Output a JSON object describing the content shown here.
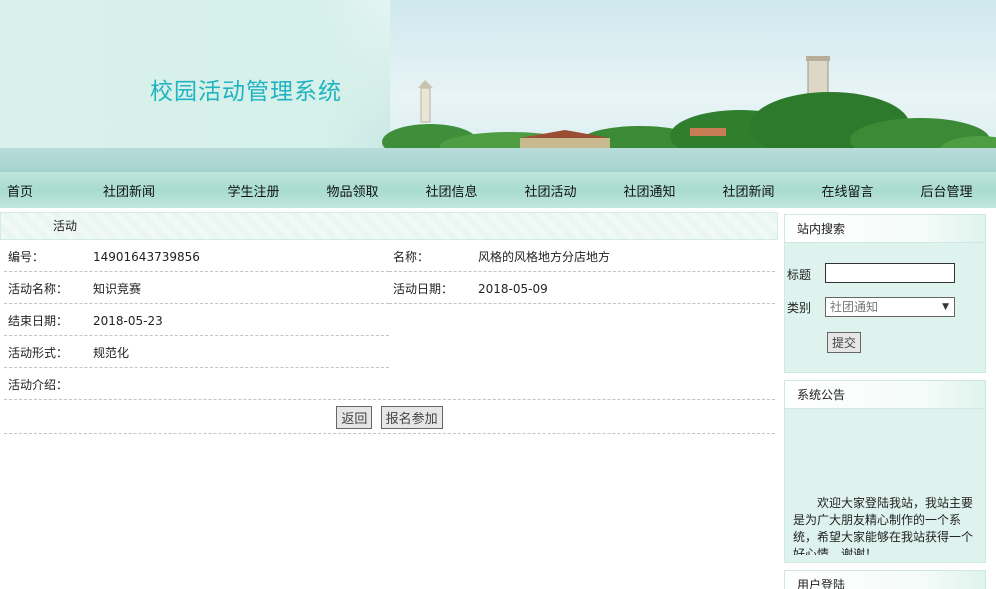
{
  "site": {
    "title": "校园活动管理系统"
  },
  "nav": [
    {
      "label": "首页"
    },
    {
      "label": "社团新闻"
    },
    {
      "label": "学生注册"
    },
    {
      "label": "物品领取"
    },
    {
      "label": "社团信息"
    },
    {
      "label": "社团活动"
    },
    {
      "label": "社团通知"
    },
    {
      "label": "社团新闻"
    },
    {
      "label": "在线留言"
    },
    {
      "label": "后台管理"
    }
  ],
  "main": {
    "heading": "活动",
    "fields": {
      "id_label": "编号：",
      "id_value": "14901643739856",
      "name_label": "名称：",
      "name_value": "风格的风格地方分店地方",
      "activity_name_label": "活动名称：",
      "activity_name_value": "知识竞赛",
      "activity_date_label": "活动日期：",
      "activity_date_value": "2018-05-09",
      "end_date_label": "结束日期：",
      "end_date_value": "2018-05-23",
      "form_label": "活动形式：",
      "form_value": "规范化",
      "intro_label": "活动介绍："
    },
    "buttons": {
      "back": "返回",
      "join": "报名参加"
    }
  },
  "sidebar": {
    "search": {
      "heading": "站内搜索",
      "title_label": "标题",
      "title_value": "",
      "category_label": "类别",
      "category_selected": "社团通知",
      "submit": "提交"
    },
    "notice": {
      "heading": "系统公告",
      "text": "欢迎大家登陆我站，我站主要是为广大朋友精心制作的一个系统，希望大家能够在我站获得一个好心情，谢谢！"
    },
    "login": {
      "heading": "用户登陆"
    }
  }
}
